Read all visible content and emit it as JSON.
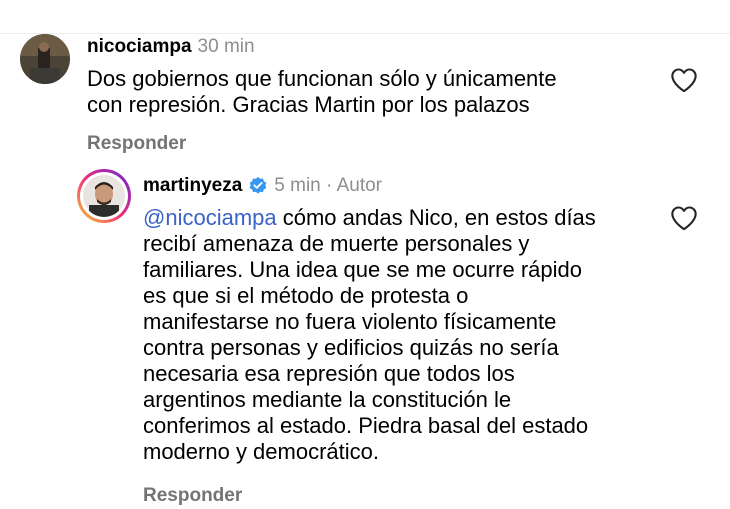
{
  "comment": {
    "username": "nicociampa",
    "time": "30 min",
    "lines": [
      "Dos gobiernos que funcionan sólo y únicamente",
      "con represión. Gracias Martin por los palazos"
    ],
    "reply_label": "Responder"
  },
  "reply": {
    "username": "martinyeza",
    "time_author": "5 min · Autor",
    "mention": "@nicociampa",
    "first_line_rest": " cómo andas Nico, en estos días",
    "lines": [
      "recibí amenaza de muerte personales y",
      "familiares. Una idea que se me ocurre rápido",
      "es que si el método de protesta o",
      "manifestarse no fuera violento físicamente",
      "contra personas y edificios quizás no sería",
      "necesaria esa represión que todos los",
      "argentinos mediante la constitución le",
      "conferimos al estado. Piedra basal del estado",
      "moderno y democrático."
    ],
    "reply_label": "Responder"
  },
  "icons": {
    "like": "heart-outline-icon",
    "verified": "verified-badge-icon"
  },
  "colors": {
    "mention": "#3a63c6",
    "meta": "#8e8e8e",
    "verified": "#3897f0",
    "story_ring": [
      "#f9ce34",
      "#ee2a7b",
      "#6228d7"
    ]
  }
}
